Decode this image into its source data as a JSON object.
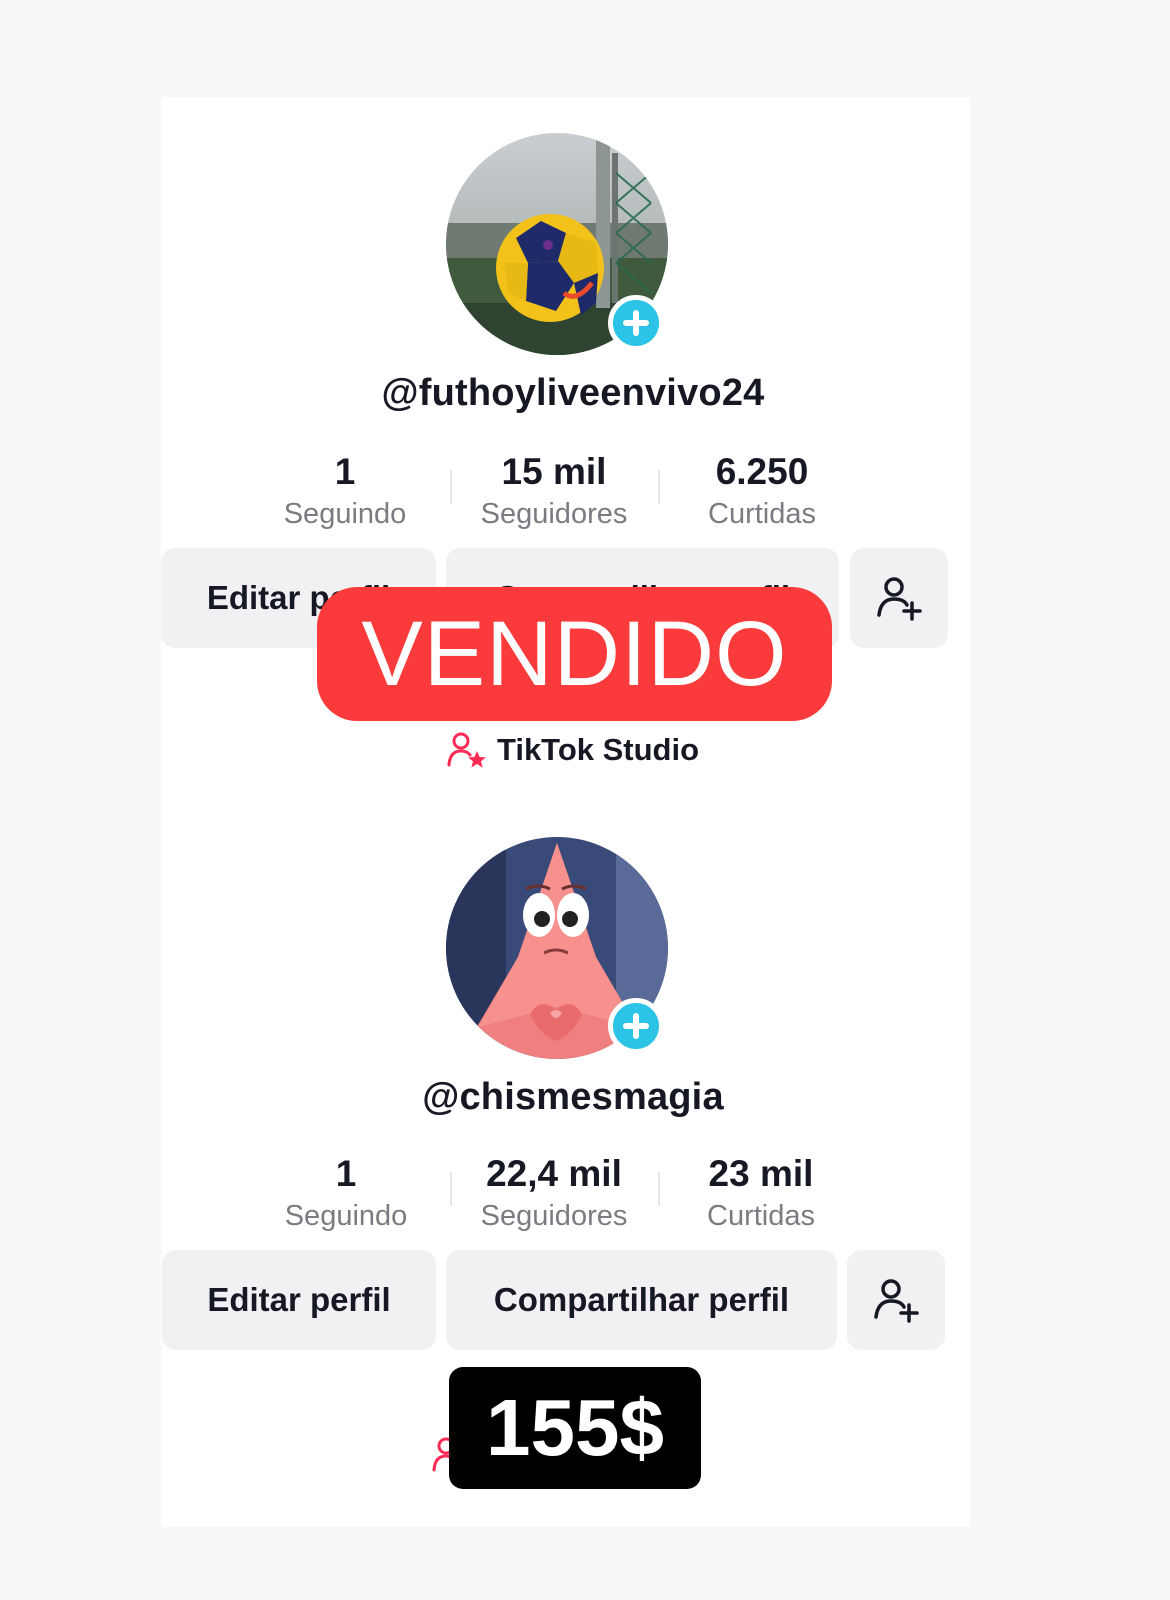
{
  "colors": {
    "badge_sold": "#fb3b3b",
    "badge_price": "#000000",
    "avatar_add": "#2bc3e6",
    "studio_accent": "#fe2c55",
    "button_bg": "#f1f1f3"
  },
  "profiles": [
    {
      "username": "@futhoyliveenvivo24",
      "avatar_icon": "soccer-ball-photo",
      "stats": [
        {
          "value": "1",
          "label": "Seguindo"
        },
        {
          "value": "15 mil",
          "label": "Seguidores"
        },
        {
          "value": "6.250",
          "label": "Curtidas"
        }
      ],
      "buttons": {
        "edit": "Editar perfil",
        "share": "Compartilhar perfil",
        "add_friend_icon": "add-person-icon"
      },
      "studio_label": "TikTok Studio"
    },
    {
      "username": "@chismesmagia",
      "avatar_icon": "patrick-star-photo",
      "stats": [
        {
          "value": "1",
          "label": "Seguindo"
        },
        {
          "value": "22,4 mil",
          "label": "Seguidores"
        },
        {
          "value": "23 mil",
          "label": "Curtidas"
        }
      ],
      "buttons": {
        "edit": "Editar perfil",
        "share": "Compartilhar perfil",
        "add_friend_icon": "add-person-icon"
      }
    }
  ],
  "overlays": {
    "sold_label": "VENDIDO",
    "price_label": "155$"
  }
}
